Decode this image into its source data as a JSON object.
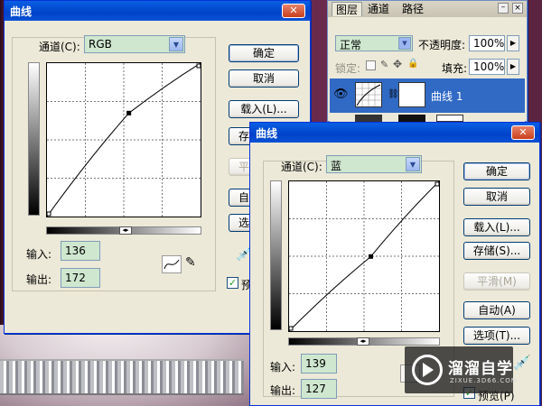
{
  "layers_panel": {
    "tabs": [
      "图层",
      "通道",
      "路径"
    ],
    "blend_mode": "正常",
    "opacity_label": "不透明度:",
    "opacity_value": "100%",
    "lock_label": "锁定:",
    "fill_label": "填充:",
    "fill_value": "100%",
    "layer_name": "曲线 1"
  },
  "curves_back": {
    "title": "曲线",
    "channel_label": "通道(C):",
    "channel_value": "RGB",
    "input_label": "输入:",
    "input_value": "136",
    "output_label": "输出:",
    "output_value": "172",
    "buttons": [
      "确定",
      "取消",
      "载入(L)...",
      "存",
      "平",
      "自",
      "选"
    ],
    "preview_label": "预",
    "curve_point": {
      "input": 136,
      "output": 172
    }
  },
  "curves_front": {
    "title": "曲线",
    "channel_label": "通道(C):",
    "channel_value": "蓝",
    "input_label": "输入:",
    "input_value": "139",
    "output_label": "输出:",
    "output_value": "127",
    "buttons": {
      "ok": "确定",
      "cancel": "取消",
      "load": "载入(L)...",
      "save": "存储(S)...",
      "smooth": "平滑(M)",
      "auto": "自动(A)",
      "options": "选项(T)...",
      "preview": "预览(P)"
    },
    "curve_point": {
      "input": 139,
      "output": 127
    }
  },
  "watermark": {
    "title": "溜溜自学",
    "subtitle": "ZIXUE.3D66.COM"
  },
  "colors": {
    "title_bar": "#0a5fe3",
    "dialog_bg": "#ece9d8",
    "field_bg": "#cfe7cf",
    "selection": "#316ac5"
  }
}
